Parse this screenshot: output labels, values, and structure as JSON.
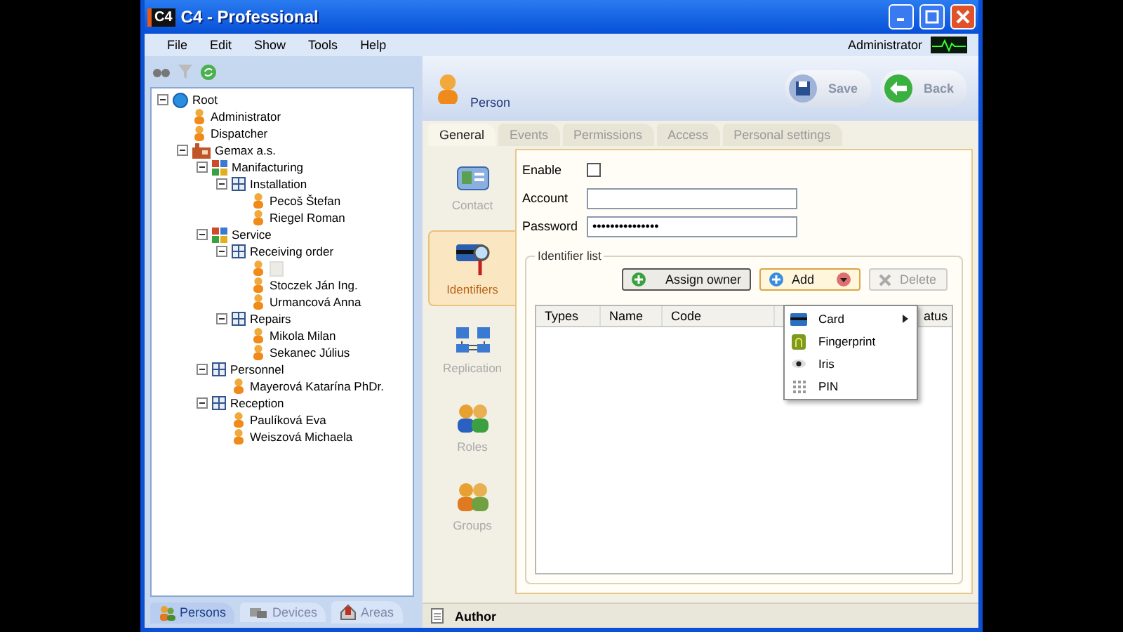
{
  "window": {
    "title": "C4 - Professional",
    "logo": "C4"
  },
  "menu": {
    "items": [
      "File",
      "Edit",
      "Show",
      "Tools",
      "Help"
    ],
    "user": "Administrator"
  },
  "tree": [
    {
      "label": "Root",
      "kind": "globe",
      "expanded": true,
      "children": [
        {
          "label": "Administrator",
          "kind": "person"
        },
        {
          "label": "Dispatcher",
          "kind": "person"
        },
        {
          "label": "Gemax a.s.",
          "kind": "company",
          "expanded": true,
          "children": [
            {
              "label": "Manifacturing",
              "kind": "division",
              "expanded": true,
              "children": [
                {
                  "label": "Installation",
                  "kind": "unit",
                  "expanded": true,
                  "children": [
                    {
                      "label": "Pecoš Štefan",
                      "kind": "person"
                    },
                    {
                      "label": "Riegel Roman",
                      "kind": "person"
                    }
                  ]
                }
              ]
            },
            {
              "label": "Service",
              "kind": "division",
              "expanded": true,
              "children": [
                {
                  "label": "Receiving order",
                  "kind": "unit",
                  "expanded": true,
                  "children": [
                    {
                      "kind": "person",
                      "editing": true
                    },
                    {
                      "label": "Stoczek Ján Ing.",
                      "kind": "person"
                    },
                    {
                      "label": "Urmancová Anna",
                      "kind": "person"
                    }
                  ]
                },
                {
                  "label": "Repairs",
                  "kind": "unit",
                  "expanded": true,
                  "children": [
                    {
                      "label": "Mikola Milan",
                      "kind": "person"
                    },
                    {
                      "label": "Sekanec Július",
                      "kind": "person"
                    }
                  ]
                }
              ]
            },
            {
              "label": "Personnel",
              "kind": "unit",
              "expanded": true,
              "children": [
                {
                  "label": "Mayerová Katarína PhDr.",
                  "kind": "person"
                }
              ]
            },
            {
              "label": "Reception",
              "kind": "unit",
              "expanded": true,
              "children": [
                {
                  "label": "Paulíková Eva",
                  "kind": "person"
                },
                {
                  "label": "Weiszová Michaela",
                  "kind": "person"
                }
              ]
            }
          ]
        }
      ]
    }
  ],
  "left_tabs": [
    {
      "label": "Persons",
      "kind": "persons",
      "selected": true
    },
    {
      "label": "Devices",
      "kind": "devices",
      "selected": false
    },
    {
      "label": "Areas",
      "kind": "areas",
      "selected": false
    }
  ],
  "header": {
    "title": "Person",
    "buttons": [
      {
        "label": "Save",
        "kind": "save"
      },
      {
        "label": "Back",
        "kind": "back"
      }
    ]
  },
  "tabs": [
    {
      "label": "General",
      "selected": true
    },
    {
      "label": "Events",
      "selected": false
    },
    {
      "label": "Permissions",
      "selected": false
    },
    {
      "label": "Access",
      "selected": false
    },
    {
      "label": "Personal settings",
      "selected": false
    }
  ],
  "side_nav": [
    {
      "label": "Contact",
      "kind": "contact",
      "selected": false
    },
    {
      "label": "Identifiers",
      "kind": "identifiers",
      "selected": true
    },
    {
      "label": "Replication",
      "kind": "replication",
      "selected": false
    },
    {
      "label": "Roles",
      "kind": "roles",
      "selected": false
    },
    {
      "label": "Groups",
      "kind": "groups",
      "selected": false
    }
  ],
  "form": {
    "enable_label": "Enable",
    "enable_checked": false,
    "account_label": "Account",
    "password_label": "Password",
    "password_value": "•••••••••••••••"
  },
  "identifier_list": {
    "title": "Identifier list",
    "buttons": [
      {
        "label": "Assign owner",
        "kind": "assign",
        "disabled": false
      },
      {
        "label": "Add",
        "kind": "add",
        "disabled": false
      },
      {
        "label": "Delete",
        "kind": "delete",
        "disabled": true
      }
    ],
    "columns": [
      "Types",
      "Name",
      "Code",
      "atus"
    ]
  },
  "add_menu": [
    {
      "label": "Card",
      "kind": "card",
      "submenu": true
    },
    {
      "label": "Fingerprint",
      "kind": "fingerprint",
      "submenu": false
    },
    {
      "label": "Iris",
      "kind": "iris",
      "submenu": false
    },
    {
      "label": "PIN",
      "kind": "pin",
      "submenu": false
    }
  ],
  "status_bar": {
    "label": "Author"
  }
}
